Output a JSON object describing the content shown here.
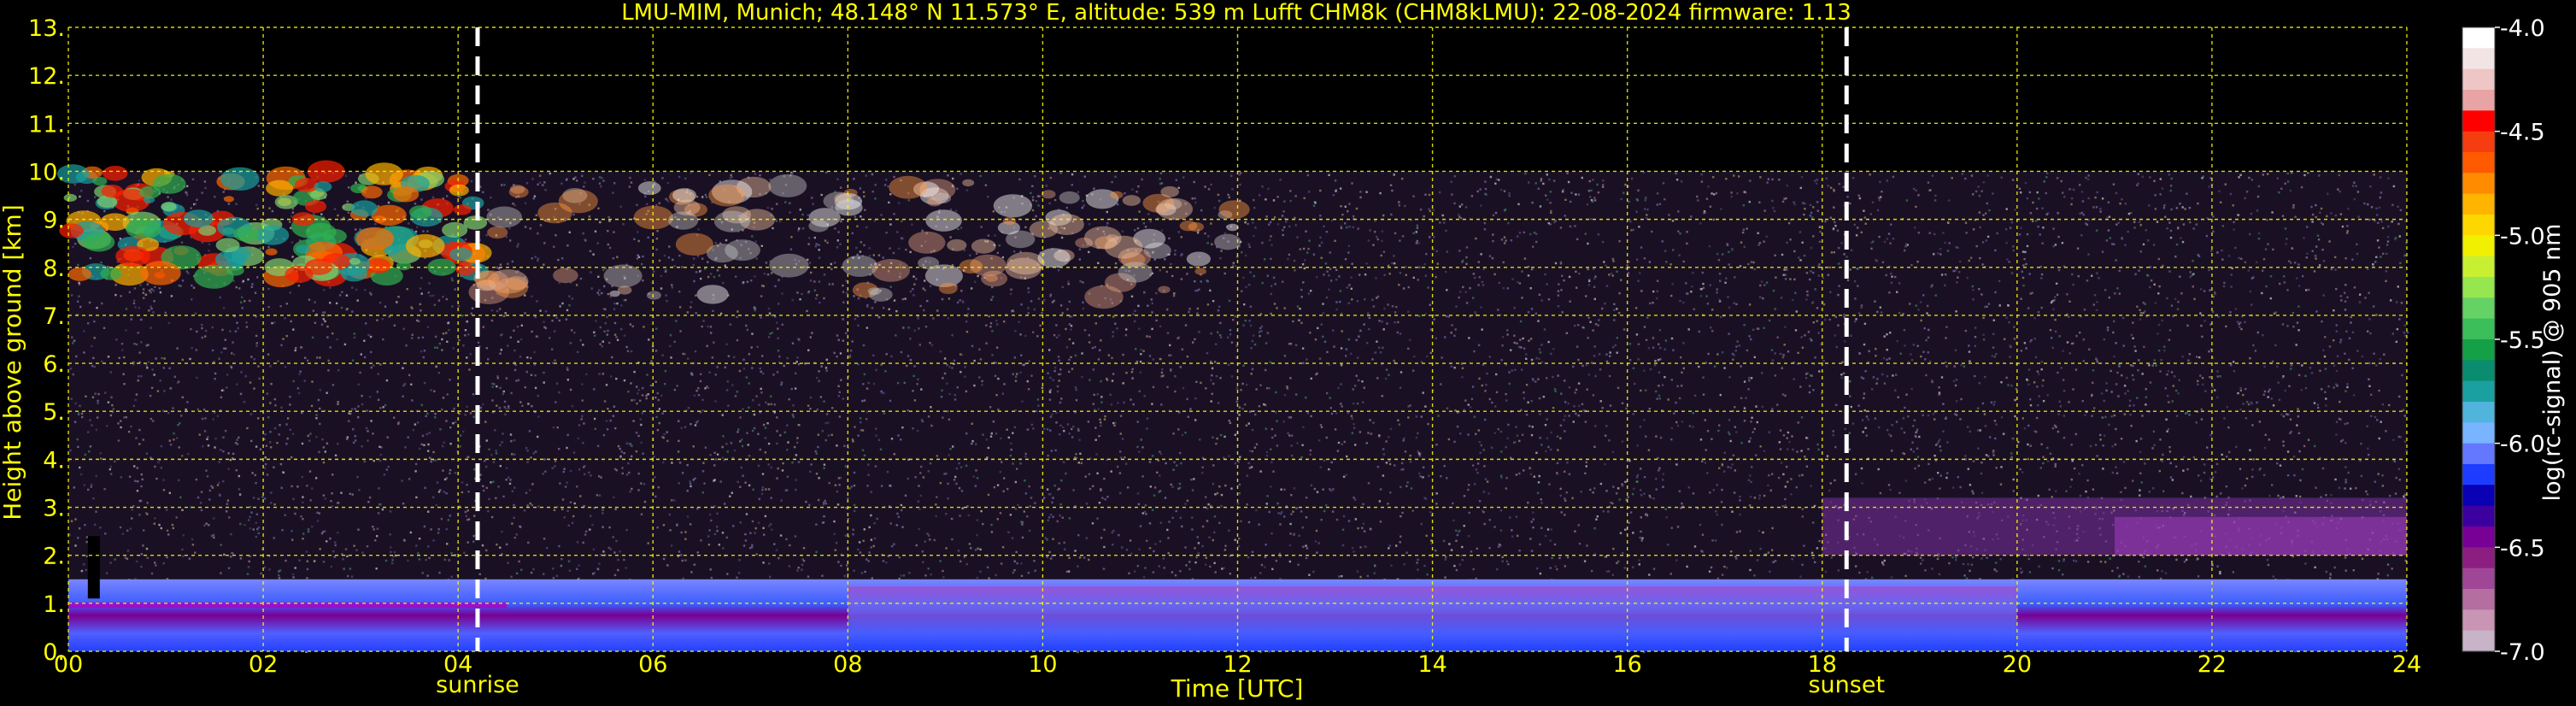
{
  "chart_data": {
    "type": "heatmap",
    "title": "LMU-MIM, Munich; 48.148° N 11.573° E, altitude: 539 m    Lufft CHM8k (CHM8kLMU): 22-08-2024    firmware: 1.13",
    "xlabel": "Time [UTC]",
    "ylabel": "Height above ground [km]",
    "xlim": [
      0,
      24
    ],
    "ylim": [
      0,
      13
    ],
    "x_ticks": [
      "00",
      "02",
      "04",
      "06",
      "08",
      "10",
      "12",
      "14",
      "16",
      "18",
      "20",
      "22",
      "24"
    ],
    "y_ticks": [
      "0.",
      "1.",
      "2.",
      "3.",
      "4.",
      "5.",
      "6.",
      "7.",
      "8.",
      "9.",
      "10.",
      "11.",
      "12.",
      "13."
    ],
    "grid": true,
    "data_top_km": 10,
    "events": [
      {
        "label": "sunrise",
        "time": 4.2
      },
      {
        "label": "sunset",
        "time": 18.25
      }
    ],
    "colorbar": {
      "label": "log(rc-signal) @ 905 nm",
      "range": [
        -7.0,
        -4.0
      ],
      "ticks": [
        "-4.0",
        "-4.5",
        "-5.0",
        "-5.5",
        "-6.0",
        "-6.5",
        "-7.0"
      ],
      "colors": [
        "#ffffff",
        "#f2e4e4",
        "#eec6c6",
        "#e8a4a4",
        "#ff0000",
        "#f53d10",
        "#ff5a00",
        "#ff8c00",
        "#ffb400",
        "#ffd700",
        "#f0f000",
        "#c8f032",
        "#96e650",
        "#64d264",
        "#3cbe5a",
        "#14a046",
        "#0a8c6e",
        "#1aa0a0",
        "#50b4dc",
        "#78b4ff",
        "#6478ff",
        "#1e3cff",
        "#0a00b4",
        "#3c00a0",
        "#780096",
        "#8c1e82",
        "#a04696",
        "#b46ea0",
        "#c896b4",
        "#c8b4c8"
      ]
    },
    "features": [
      {
        "type": "cirrus",
        "x_range": [
          0,
          4.2
        ],
        "height_km": [
          7.8,
          10
        ],
        "value_approx": -5.0
      },
      {
        "type": "cirrus",
        "x_range": [
          4.2,
          12
        ],
        "height_km": [
          7.3,
          9.8
        ],
        "value_approx": -5.8
      },
      {
        "type": "boundary_layer",
        "x_range": [
          0,
          24
        ],
        "height_km": [
          0,
          1.5
        ],
        "value_approx": -6.3
      },
      {
        "type": "aerosol_layer",
        "x_range": [
          18,
          24
        ],
        "height_km": [
          2.0,
          3.2
        ],
        "value_approx": -6.6
      }
    ]
  }
}
